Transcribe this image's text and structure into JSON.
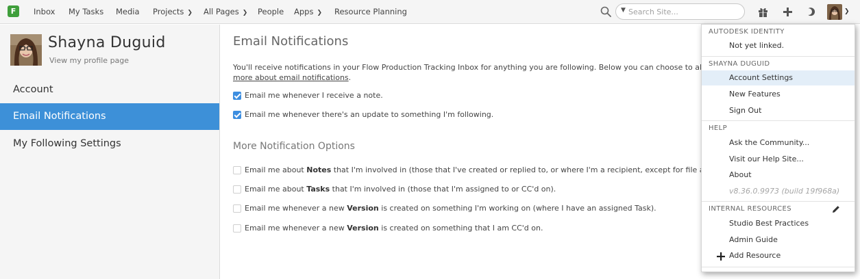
{
  "nav": {
    "logo_letter": "F",
    "items": [
      "Inbox",
      "My Tasks",
      "Media",
      "Projects",
      "All Pages",
      "People",
      "Apps",
      "Resource Planning"
    ],
    "search_placeholder": "Search Site..."
  },
  "sidebar": {
    "user_name": "Shayna Duguid",
    "profile_link": "View my profile page",
    "items": [
      {
        "label": "Account",
        "active": false
      },
      {
        "label": "Email Notifications",
        "active": true
      },
      {
        "label": "My Following Settings",
        "active": false
      }
    ]
  },
  "main": {
    "title": "Email Notifications",
    "intro_text": "You'll receive notifications in your Flow Production Tracking Inbox for anything you are following. Below you can choose to also recei",
    "intro_link": "more about email notifications",
    "intro_link_suffix": ".",
    "primary_options": [
      {
        "label": "Email me whenever I receive a note.",
        "checked": true
      },
      {
        "label": "Email me whenever there's an update to something I'm following.",
        "checked": true
      }
    ],
    "more_title": "More Notification Options",
    "more_options": [
      {
        "pre": "Email me about ",
        "bold": "Notes",
        "post": " that I'm involved in (those that I've created or replied to, or where I'm a recipient, except for file attachmer",
        "checked": false
      },
      {
        "pre": "Email me about ",
        "bold": "Tasks",
        "post": " that I'm involved in (those that I'm assigned to or CC'd on).",
        "checked": false
      },
      {
        "pre": "Email me whenever a new ",
        "bold": "Version",
        "post": " is created on something I'm working on (where I have an assigned Task).",
        "checked": false
      },
      {
        "pre": "Email me whenever a new ",
        "bold": "Version",
        "post": " is created on something that I am CC'd on.",
        "checked": false
      }
    ]
  },
  "menu": {
    "section_autodesk": "AUTODESK IDENTITY",
    "not_linked": "Not yet linked.",
    "section_user": "SHAYNA DUGUID",
    "account_settings": "Account Settings",
    "new_features": "New Features",
    "sign_out": "Sign Out",
    "section_help": "HELP",
    "ask_community": "Ask the Community...",
    "help_site": "Visit our Help Site...",
    "about": "About",
    "version": "v8.36.0.9973 (build 19f968a)",
    "section_internal": "INTERNAL RESOURCES",
    "studio_best_practices": "Studio Best Practices",
    "admin_guide": "Admin Guide",
    "add_resource": "Add Resource"
  },
  "colors": {
    "accent_blue": "#3d90d8",
    "logo_green": "#3f9e3b",
    "menu_highlight": "#e3eef8"
  }
}
